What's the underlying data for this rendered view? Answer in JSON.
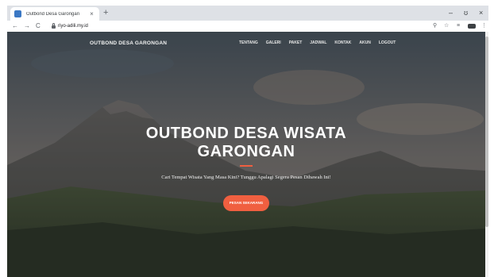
{
  "browser": {
    "tab_title": "Outbond Desa Garongan",
    "tab_close": "×",
    "new_tab": "+",
    "url": "riyo-adili.my.id",
    "nav": {
      "back": "←",
      "forward": "→",
      "reload": "C"
    },
    "window_controls": {
      "minimize": "–",
      "restore": "ʊ",
      "close": "×"
    },
    "toolbar_icons": {
      "zoom": "⚲",
      "bookmark": "☆",
      "media": "≡",
      "menu": "⋮"
    }
  },
  "site": {
    "brand": "OUTBOND DESA GARONGAN",
    "menu": [
      "TENTANG",
      "GALERI",
      "PAKET",
      "JADWAL",
      "KONTAK",
      "AKUN",
      "LOGOUT"
    ],
    "hero_title_line1": "OUTBOND DESA WISATA",
    "hero_title_line2": "GARONGAN",
    "subtitle": "Cari Tempat Wisata Yang Masa Kini? Tunggu Apalagi Segera Pesan Dibawah Ini!",
    "cta": "PESAN SEKARANG",
    "accent_color": "#f05f40"
  }
}
